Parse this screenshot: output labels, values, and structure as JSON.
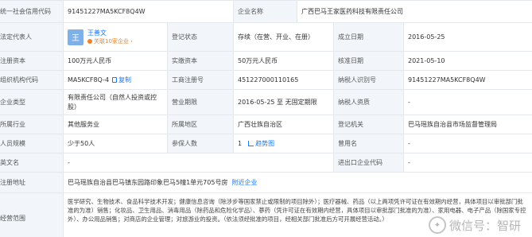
{
  "rows": {
    "r1": {
      "credit_code_label": "统一社会信用代码",
      "credit_code": "91451227MA5KCF8Q4W",
      "company_name_label": "企业名称",
      "company_name": "广西巴马王家医药科技有限责任公司"
    },
    "r2": {
      "legal_rep_label": "法定代表人",
      "avatar_char": "王",
      "legal_rep_name": "王善文",
      "related_text": "关联10家企业 ›",
      "status_label": "登记状态",
      "status": "存续（在营、开业、在册）",
      "found_date_label": "成立日期",
      "found_date": "2016-05-25"
    },
    "r3": {
      "reg_capital_label": "注册资本",
      "reg_capital": "100万元人民币",
      "paid_capital_label": "实缴资本",
      "paid_capital": "50万元人民币",
      "approve_date_label": "核准日期",
      "approve_date": "2021-05-10"
    },
    "r4": {
      "org_code_label": "组织机构代码",
      "org_code": "MA5KCF8Q-4",
      "copy_label": "复制",
      "biz_reg_label": "工商注册号",
      "biz_reg": "451227000110165",
      "taxpayer_id_label": "纳税人识别号",
      "taxpayer_id": "91451227MA5KCF8Q4W"
    },
    "r5": {
      "company_type_label": "企业类型",
      "company_type": "有限责任公司（自然人投资或控股）",
      "term_label": "营业期限",
      "term": "2016-05-25 至 无固定期限",
      "taxpayer_qual_label": "纳税人资质",
      "taxpayer_qual": "-"
    },
    "r6": {
      "industry_label": "所属行业",
      "industry": "其他服务业",
      "region_label": "所属地区",
      "region": "广西壮族自治区",
      "authority_label": "登记机关",
      "authority": "巴马瑶族自治县市场监督管理局"
    },
    "r7": {
      "staff_label": "人员规模",
      "staff": "少于50人",
      "insured_label": "参保人数",
      "insured": "1",
      "trend_label": "趋势图",
      "former_name_label": "曾用名",
      "former_name": "-"
    },
    "r8": {
      "english_name_label": "英文名",
      "english_name": "-",
      "export_code_label": "进出口企业代码",
      "export_code": "-"
    },
    "r9": {
      "address_label": "注册地址",
      "address": "巴马瑶族自治县巴马镇东园路印象巴马5幢1单元705号房",
      "nearby_label": "附近企业"
    },
    "r10": {
      "scope_label": "经营范围",
      "scope": "医学研究、生物技术、食品科学技术开发；健康信息咨询（除涉步等国家禁止或限制的项目除外）；医疗器械、药品（以上两项凭许可证在有效期内经营，具体项目以审批部门批准的为准）销售；化妆品、卫生用品、消毒用品（除药品和危险化学品）、蔘药（凭许可证在有效期内经营，具体项目以审批部门批准的为准）、家用电器、电子产品（除国家专控外）、办公用品销售；对商店的企业管理；对旅游业的投资。（依法须经批准的项目，经相关部门批准后方可开展经营活动。）"
    }
  },
  "watermark": {
    "icon": "wechat-icon",
    "text": "微信号：智研"
  }
}
